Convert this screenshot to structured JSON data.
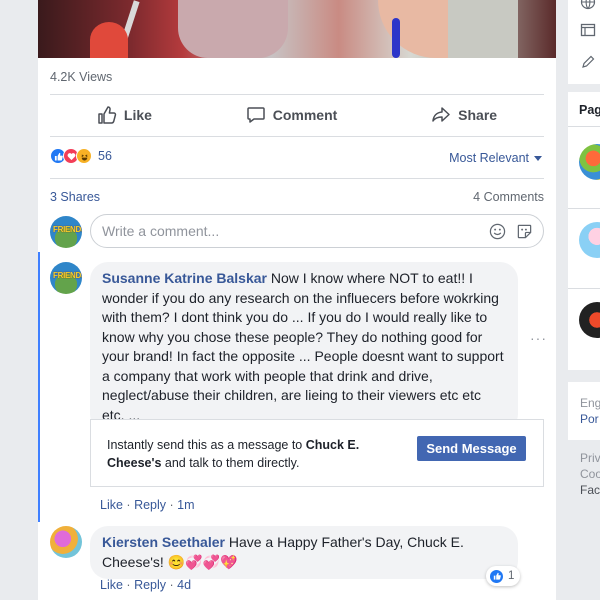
{
  "post": {
    "views": "4.2K Views",
    "actions": {
      "like": "Like",
      "comment": "Comment",
      "share": "Share"
    },
    "reaction_count": "56",
    "sort": "Most Relevant",
    "shares": "3 Shares",
    "comments_count": "4 Comments",
    "comment_placeholder": "Write a comment...",
    "avatar_text": "FRIENDS"
  },
  "comments": [
    {
      "author": "Susanne Katrine Balskar",
      "text": "Now I know where NOT to eat!! I wonder if you do any research on the influecers before wokrking with them? I dont think you do ... If you do I would really like to know why you chose these people? They do nothing good for your brand! In fact the opposite ... People doesnt want to support a company that work with people that drink and drive, neglect/abuse their children, are lieing to their viewers etc etc etc. ...",
      "like_label": "Like",
      "reply_label": "Reply",
      "time": "1m",
      "more": "···"
    },
    {
      "author": "Kiersten Seethaler",
      "text": "Have a Happy Father's Day, Chuck E. Cheese's! 😊💞💞💖",
      "like_label": "Like",
      "reply_label": "Reply",
      "time": "4d",
      "reaction_count": "1"
    }
  ],
  "promo": {
    "text_before": "Instantly send this as a message to ",
    "page_name": "Chuck E. Cheese's",
    "text_after": " and talk to them directly.",
    "button": "Send Message"
  },
  "sidebar": {
    "pages_title": "Pag",
    "lang_line1": "Eng",
    "lang_line2": "Por",
    "footer": [
      "Priv",
      "Coo",
      "Fac"
    ]
  },
  "colors": {
    "link": "#385898",
    "button": "#4267b2",
    "like_blue": "#2078f4",
    "love_red": "#f33e58",
    "haha_yellow": "#f7b125",
    "thread_bar": "#4080ff"
  }
}
